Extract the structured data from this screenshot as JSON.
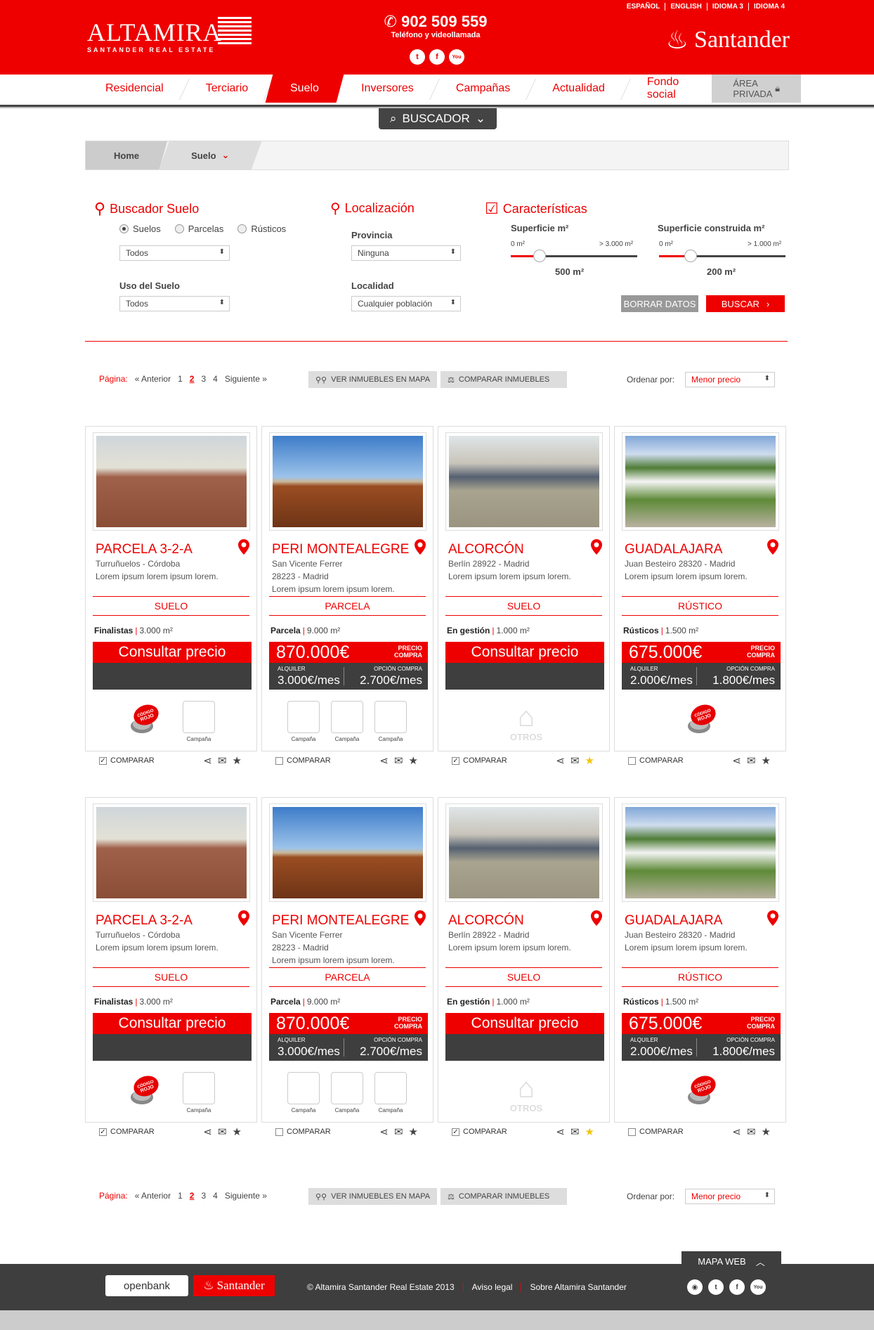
{
  "header": {
    "logo_name": "ALTAMIRA",
    "logo_sub": "SANTANDER REAL ESTATE",
    "phone": "902 509 559",
    "phone_text": "Teléfono y videollamada",
    "languages": [
      "ESPAÑOL",
      "ENGLISH",
      "IDIOMA 3",
      "IDIOMA 4"
    ],
    "brand": "Santander",
    "social_icons": [
      "twitter-icon",
      "facebook-icon",
      "youtube-icon"
    ]
  },
  "nav": {
    "items": [
      "Residencial",
      "Terciario",
      "Suelo",
      "Inversores",
      "Campañas",
      "Actualidad",
      "Fondo social"
    ],
    "active": "Suelo",
    "private": "ÁREA PRIVADA"
  },
  "buscador_tab": "BUSCADOR",
  "breadcrumb": {
    "home": "Home",
    "current": "Suelo"
  },
  "search": {
    "title": "Buscador Suelo",
    "radios": [
      "Suelos",
      "Parcelas",
      "Rústicos"
    ],
    "radio_selected": "Suelos",
    "type_select": "Todos",
    "uso_label": "Uso del Suelo",
    "uso_select": "Todos",
    "loc_title": "Localización",
    "provincia_label": "Provincia",
    "provincia_value": "Ninguna",
    "localidad_label": "Localidad",
    "localidad_value": "Cualquier población",
    "car_title": "Características",
    "sup_label": "Superficie m²",
    "sup_min": "0 m²",
    "sup_max": "> 3.000 m²",
    "sup_value": "500 m²",
    "sup_level": 0.23,
    "supc_label": "Superficie construida m²",
    "supc_min": "0 m²",
    "supc_max": "> 1.000 m²",
    "supc_value": "200 m²",
    "supc_level": 0.25,
    "clear": "BORRAR DATOS",
    "search": "BUSCAR"
  },
  "pagination": {
    "label": "Página:",
    "prev": "« Anterior",
    "pages": [
      "1",
      "2",
      "3",
      "4"
    ],
    "current": "2",
    "next": "Siguiente »",
    "map_btn": "VER INMUEBLES EN MAPA",
    "compare_btn": "COMPARAR INMUEBLES",
    "sort_label": "Ordenar por:",
    "sort_value": "Menor precio"
  },
  "cards": [
    {
      "title": "PARCELA 3-2-A",
      "addr": [
        "Turruñuelos - Córdoba",
        "Lorem ipsum lorem ipsum lorem."
      ],
      "tag": "SUELO",
      "feat_label": "Finalistas",
      "feat_value": "3.000 m²",
      "consult": "Consultar precio",
      "campaign": "Campaña",
      "badge": "CÓDIGO ROJO",
      "compare": "COMPARAR",
      "checked": true,
      "starred": false
    },
    {
      "title": "PERI MONTEALEGRE",
      "addr": [
        "San Vicente Ferrer",
        "28223 - Madrid",
        "Lorem ipsum lorem ipsum lorem."
      ],
      "tag": "PARCELA",
      "feat_label": "Parcela",
      "feat_value": "9.000 m²",
      "price": "870.000€",
      "price_label": [
        "PRECIO",
        "COMPRA"
      ],
      "rent_label": "ALQUILER",
      "rent": "3.000€/mes",
      "option_label": "OPCIÓN COMPRA",
      "option": "2.700€/mes",
      "campaign": "Campaña",
      "compare": "COMPARAR",
      "checked": false,
      "starred": false
    },
    {
      "title": "ALCORCÓN",
      "addr": [
        "Berlín 28922 - Madrid",
        "Lorem ipsum lorem ipsum lorem."
      ],
      "tag": "SUELO",
      "feat_label": "En gestión",
      "feat_value": "1.000 m²",
      "consult": "Consultar precio",
      "otros": "OTROS",
      "compare": "COMPARAR",
      "checked": true,
      "starred": true
    },
    {
      "title": "GUADALAJARA",
      "addr": [
        "Juan Besteiro 28320 - Madrid",
        "Lorem ipsum lorem ipsum lorem."
      ],
      "tag": "RÚSTICO",
      "feat_label": "Rústicos",
      "feat_value": "1.500 m²",
      "price": "675.000€",
      "price_label": [
        "PRECIO",
        "COMPRA"
      ],
      "rent_label": "ALQUILER",
      "rent": "2.000€/mes",
      "option_label": "OPCIÓN COMPRA",
      "option": "1.800€/mes",
      "badge": "CÓDIGO ROJO",
      "compare": "COMPARAR",
      "checked": false,
      "starred": false
    }
  ],
  "footer": {
    "mapa_web": "MAPA WEB",
    "openbank": "openbank",
    "santander": "Santander",
    "links": [
      "© Altamira Santander Real Estate 2013",
      "Aviso legal",
      "Sobre Altamira Santander"
    ],
    "social_icons": [
      "rss-icon",
      "twitter-icon",
      "facebook-icon",
      "youtube-icon"
    ]
  }
}
